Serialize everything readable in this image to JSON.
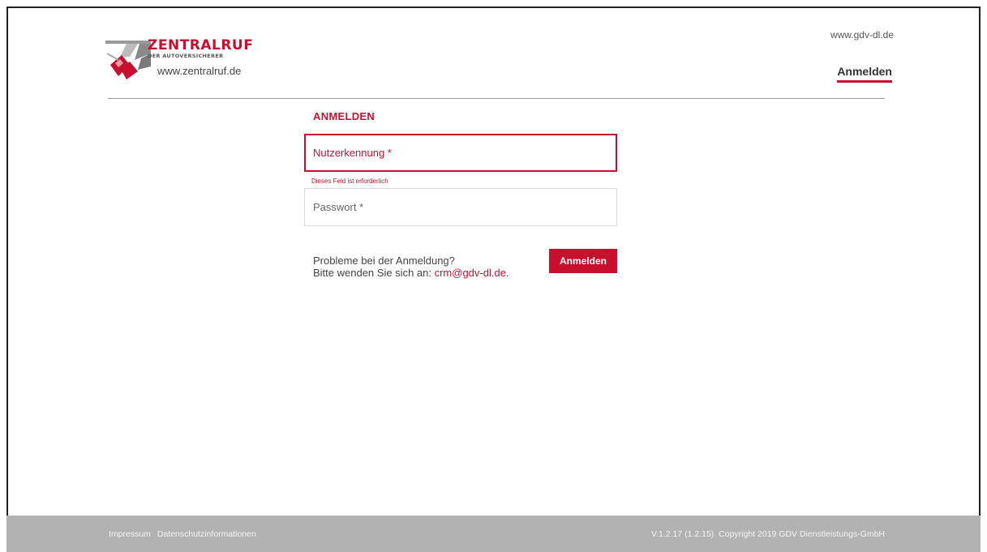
{
  "header": {
    "logo": {
      "brand": "ZENTRALRUF",
      "subtitle": "DER AUTOVERSICHERER",
      "url": "www.zentralruf.de"
    },
    "external_link": "www.gdv-dl.de",
    "nav_login": "Anmelden"
  },
  "form": {
    "title": "ANMELDEN",
    "username": {
      "placeholder": "Nutzerkennung *",
      "value": "",
      "error": "Dieses Feld ist erforderlich"
    },
    "password": {
      "placeholder": "Passwort *",
      "value": ""
    },
    "help_line1": "Probleme bei der Anmeldung?",
    "help_line2": "Bitte wenden Sie sich an: ",
    "help_email": "crm@gdv-dl.de",
    "help_suffix": ".",
    "submit_label": "Anmelden"
  },
  "footer": {
    "impressum": "Impressum",
    "privacy": "Datenschutzinformationen",
    "version": "V.1.2.17 (1.2.15)",
    "copyright": "Copyright 2019 GDV Dienstleistungs-GmbH"
  },
  "colors": {
    "accent": "#c8102e",
    "footer_bg": "#b2b2b2"
  }
}
